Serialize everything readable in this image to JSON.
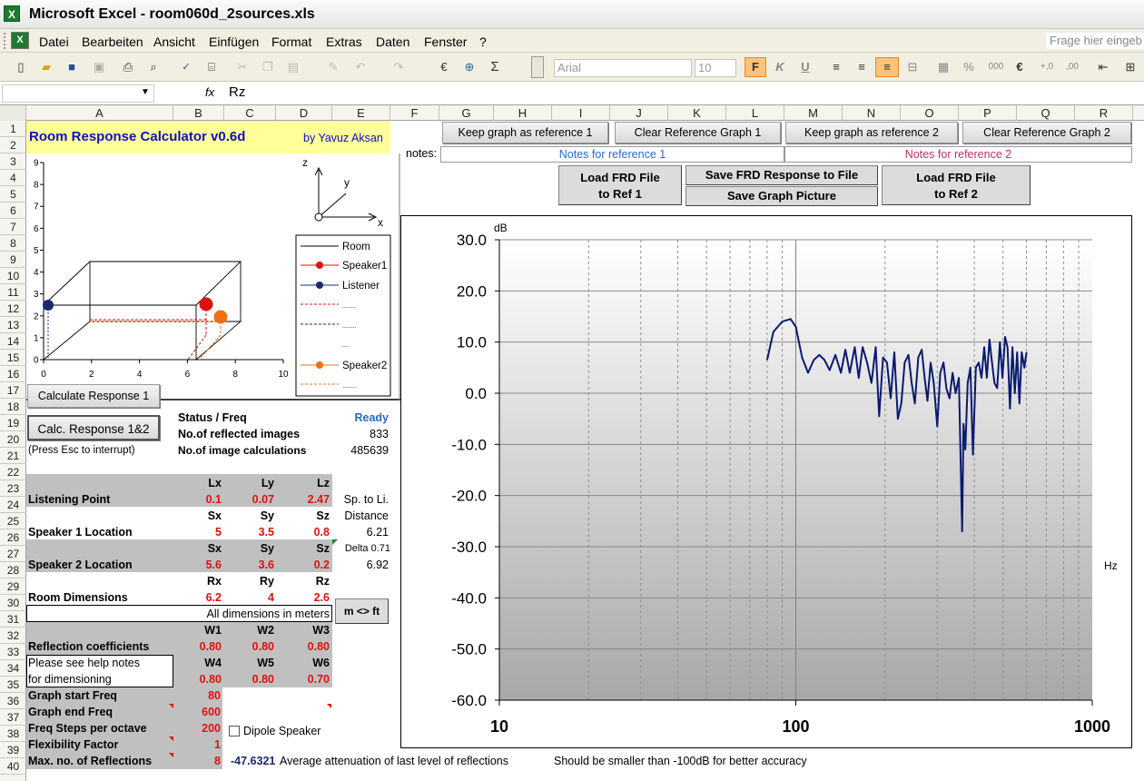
{
  "app": {
    "title": "Microsoft Excel - room060d_2sources.xls"
  },
  "menu": [
    "Datei",
    "Bearbeiten",
    "Ansicht",
    "Einfügen",
    "Format",
    "Extras",
    "Daten",
    "Fenster",
    "?"
  ],
  "help_box": "Frage hier eingeb",
  "font": {
    "name": "Arial",
    "size": "10"
  },
  "formula": {
    "fx": "fx",
    "content": "Rz"
  },
  "columns": [
    "A",
    "B",
    "C",
    "D",
    "E",
    "F",
    "G",
    "H",
    "I",
    "J",
    "K",
    "L",
    "M",
    "N",
    "O",
    "P",
    "Q",
    "R"
  ],
  "rows": [
    "1",
    "2",
    "3",
    "4",
    "5",
    "6",
    "7",
    "8",
    "9",
    "10",
    "11",
    "12",
    "13",
    "14",
    "15",
    "16",
    "17",
    "18",
    "19",
    "20",
    "21",
    "22",
    "23",
    "24",
    "25",
    "26",
    "27",
    "28",
    "29",
    "30",
    "31",
    "32",
    "33",
    "34",
    "35",
    "36",
    "37",
    "38",
    "39",
    "40"
  ],
  "sheet": {
    "title": "Room Response Calculator  v0.6d",
    "author": "by Yavuz Aksan",
    "btn_keep1": "Keep graph as reference 1",
    "btn_clear1": "Clear Reference Graph 1",
    "btn_keep2": "Keep graph as reference 2",
    "btn_clear2": "Clear Reference Graph 2",
    "notes_label": "notes:",
    "notes1": "Notes for reference 1",
    "notes2": "Notes for reference 2",
    "btn_load1_a": "Load FRD File",
    "btn_load1_b": "to Ref 1",
    "btn_save_frd": "Save FRD Response to File",
    "btn_save_pic": "Save Graph Picture",
    "btn_load2_a": "Load FRD File",
    "btn_load2_b": "to Ref 2",
    "btn_calc1": "Calculate Response 1",
    "btn_calc12": "Calc. Response 1&2",
    "press_esc": "(Press Esc to interrupt)",
    "status_label": "Status / Freq",
    "status_value": "Ready",
    "reflected_label": "No.of reflected images",
    "reflected_value": "833",
    "calc_label": "No.of image calculations",
    "calc_value": "485639",
    "lp_label": "Listening Point",
    "lp_h": [
      "Lx",
      "Ly",
      "Lz"
    ],
    "lp": [
      "0.1",
      "0.07",
      "2.47"
    ],
    "sp_to_li": "Sp. to Li.",
    "distance": "Distance",
    "s1_label": "Speaker 1 Location",
    "s1_h": [
      "Sx",
      "Sy",
      "Sz"
    ],
    "s1": [
      "5",
      "3.5",
      "0.8"
    ],
    "d1": "6.21",
    "s2_label": "Speaker 2 Location",
    "s2_h": [
      "Sx",
      "Sy",
      "Sz"
    ],
    "s2": [
      "5.6",
      "3.6",
      "0.2"
    ],
    "delta": "Delta 0.71",
    "d2": "6.92",
    "room_label": "Room Dimensions",
    "room_h": [
      "Rx",
      "Ry",
      "Rz"
    ],
    "room": [
      "6.2",
      "4",
      "2.6"
    ],
    "all_dims": "All dimensions in meters",
    "btn_units": "m <> ft",
    "refl_label": "Reflection coefficients",
    "w_h1": [
      "W1",
      "W2",
      "W3"
    ],
    "w1": [
      "0.80",
      "0.80",
      "0.80"
    ],
    "help1": "Please see help notes",
    "help2": "for dimensioning",
    "w_h2": [
      "W4",
      "W5",
      "W6"
    ],
    "w2": [
      "0.80",
      "0.80",
      "0.70"
    ],
    "gs_label": "Graph start Freq",
    "gs": "80",
    "ge_label": "Graph end Freq",
    "ge": "600",
    "fs_label": "Freq Steps per octave",
    "fs": "200",
    "ff_label": "Flexibility Factor",
    "ff": "1",
    "mr_label": "Max. no. of Reflections",
    "mr": "8",
    "dipole": "Dipole Speaker",
    "atten_value": "-47.6321",
    "atten_text": "Average attenuation of last level of reflections",
    "accuracy_text": "Should be smaller than -100dB for better accuracy"
  },
  "room_plot": {
    "x_ticks": [
      "0",
      "2",
      "4",
      "6",
      "8",
      "10"
    ],
    "y_ticks": [
      "0",
      "1",
      "2",
      "3",
      "4",
      "5",
      "6",
      "7",
      "8",
      "9"
    ],
    "axes": {
      "z": "z",
      "y": "y",
      "x": "x"
    },
    "legend": [
      "Room",
      "Speaker1",
      "Listener",
      "........",
      "........",
      "....",
      "Speaker2",
      "........"
    ],
    "colors": {
      "speaker1": "#e01010",
      "listener": "#1a2a6c",
      "speaker2": "#f07010"
    }
  },
  "chart_data": {
    "type": "line",
    "ylabel": "dB",
    "xlabel": "Hz",
    "xscale": "log",
    "xlim": [
      10,
      1000
    ],
    "ylim": [
      -60,
      30
    ],
    "x_ticks": [
      "10",
      "100",
      "1000"
    ],
    "y_ticks": [
      "30.0",
      "20.0",
      "10.0",
      "0.0",
      "-10.0",
      "-20.0",
      "-30.0",
      "-40.0",
      "-50.0",
      "-60.0"
    ],
    "series": [
      {
        "color": "#0a1a6e",
        "points": [
          [
            80,
            6.5
          ],
          [
            84,
            12
          ],
          [
            90,
            14
          ],
          [
            96,
            14.5
          ],
          [
            100,
            13
          ],
          [
            105,
            7
          ],
          [
            110,
            4
          ],
          [
            115,
            6.5
          ],
          [
            120,
            7.5
          ],
          [
            125,
            6.5
          ],
          [
            130,
            4.5
          ],
          [
            136,
            7.5
          ],
          [
            142,
            4
          ],
          [
            147,
            8.5
          ],
          [
            152,
            4
          ],
          [
            158,
            9
          ],
          [
            163,
            3
          ],
          [
            168,
            9
          ],
          [
            174,
            6
          ],
          [
            180,
            2
          ],
          [
            186,
            9
          ],
          [
            191,
            -4.5
          ],
          [
            197,
            7
          ],
          [
            203,
            6
          ],
          [
            209,
            -1
          ],
          [
            215,
            8
          ],
          [
            221,
            -5
          ],
          [
            227,
            -2
          ],
          [
            233,
            6
          ],
          [
            240,
            7.5
          ],
          [
            246,
            2
          ],
          [
            252,
            -2
          ],
          [
            259,
            7
          ],
          [
            266,
            8.5
          ],
          [
            272,
            3
          ],
          [
            278,
            -1.5
          ],
          [
            285,
            6
          ],
          [
            292,
            2
          ],
          [
            300,
            -6.5
          ],
          [
            307,
            4
          ],
          [
            315,
            6
          ],
          [
            322,
            1
          ],
          [
            330,
            -1
          ],
          [
            338,
            4
          ],
          [
            346,
            0
          ],
          [
            355,
            3
          ],
          [
            364,
            -27
          ],
          [
            368,
            -6
          ],
          [
            373,
            -11
          ],
          [
            380,
            2
          ],
          [
            388,
            5
          ],
          [
            396,
            -12
          ],
          [
            405,
            5
          ],
          [
            414,
            6
          ],
          [
            423,
            3
          ],
          [
            432,
            9
          ],
          [
            441,
            3
          ],
          [
            450,
            10.5
          ],
          [
            459,
            6
          ],
          [
            468,
            2
          ],
          [
            478,
            1
          ],
          [
            488,
            10
          ],
          [
            498,
            3
          ],
          [
            508,
            11
          ],
          [
            518,
            9
          ],
          [
            528,
            -3
          ],
          [
            538,
            9
          ],
          [
            548,
            0
          ],
          [
            558,
            8
          ],
          [
            568,
            -2
          ],
          [
            578,
            8
          ],
          [
            590,
            5
          ],
          [
            600,
            8
          ]
        ]
      }
    ]
  }
}
